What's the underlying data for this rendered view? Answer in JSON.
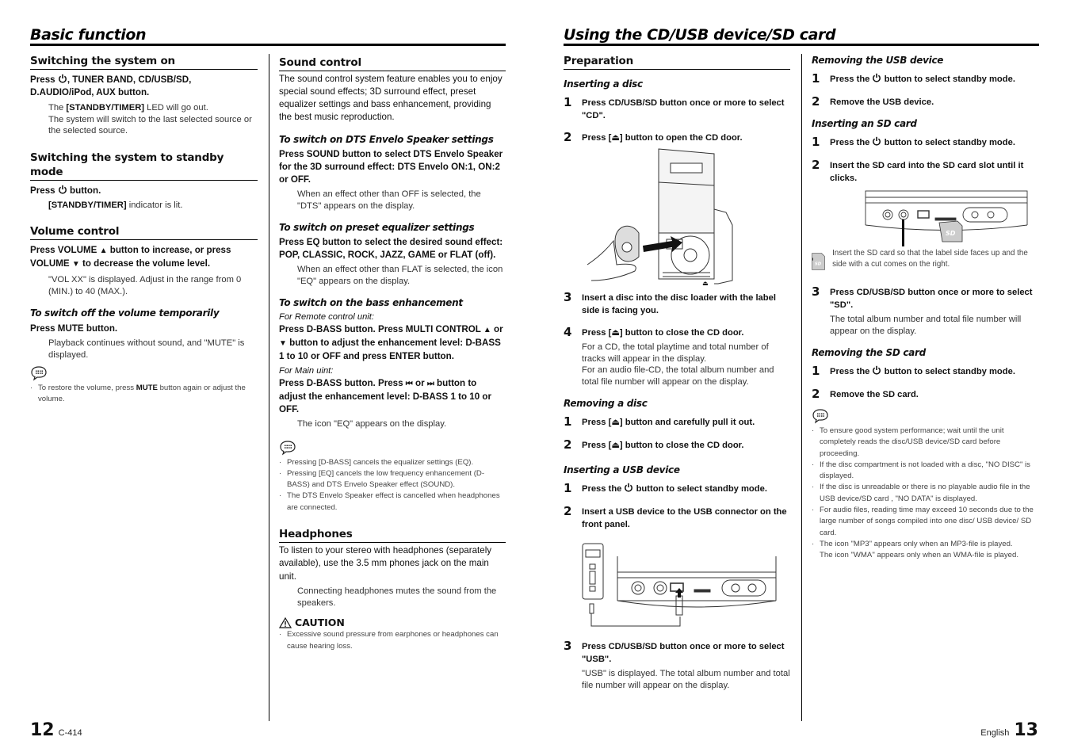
{
  "left_page": {
    "title": "Basic function",
    "page_number": "12",
    "model": "C-414",
    "sections": {
      "switch_on": {
        "heading": "Switching the system on",
        "instr_pre": "Press ",
        "instr_post": ", TUNER BAND, CD/USB/SD, D.AUDIO/iPod, AUX button.",
        "note1_pre": "The ",
        "note1_bold": "[STANDBY/TIMER]",
        "note1_post": " LED will go out.",
        "note2": "The system will switch to the last selected source or the selected source."
      },
      "standby": {
        "heading": "Switching the system to standby mode",
        "instr_pre": "Press ",
        "instr_post": " button.",
        "note_bold": "[STANDBY/TIMER]",
        "note_post": " indicator is lit."
      },
      "volume": {
        "heading": "Volume control",
        "instr_a": "Press VOLUME ",
        "up_glyph": "▲",
        "instr_b": " button to increase, or press VOLUME ",
        "down_glyph": "▼",
        "instr_c": " to decrease the volume level.",
        "note": "\"VOL XX\" is displayed. Adjust in the range from 0 (MIN.) to 40 (MAX.).",
        "mute_heading": "To switch off the volume temporarily",
        "mute_instr": "Press MUTE button.",
        "mute_note": "Playback continues without sound, and \"MUTE\" is displayed.",
        "memo_pre": "To restore the volume, press ",
        "memo_bold": "MUTE",
        "memo_post": " button again or adjust the volume."
      },
      "sound": {
        "heading": "Sound control",
        "intro": "The sound control system feature enables you to enjoy special sound effects; 3D surround effect, preset equalizer settings and bass enhancement, providing the best music reproduction.",
        "dts_heading": "To switch on DTS Envelo Speaker settings",
        "dts_instr": "Press SOUND button to select DTS Envelo Speaker for the 3D surround effect: DTS Envelo ON:1, ON:2 or OFF.",
        "dts_note": "When an effect other than OFF is selected, the \"DTS\" appears on the display.",
        "eq_heading": "To switch on preset equalizer settings",
        "eq_instr": "Press EQ button to select the desired sound effect: POP, CLASSIC, ROCK, JAZZ, GAME or FLAT (off).",
        "eq_note": "When an effect other than FLAT is selected, the icon \"EQ\" appears on the display.",
        "bass_heading": "To switch on the bass enhancement",
        "remote_label": "For Remote control unit:",
        "remote_instr_a": "Press D-BASS button. Press MULTI CONTROL ",
        "up_glyph": "▲",
        "remote_instr_b": " or ",
        "down_glyph": "▼",
        "remote_instr_c": " button to adjust the enhancement level: D-BASS 1 to 10 or OFF and press ENTER button.",
        "main_label": "For Main uint:",
        "main_instr_a": "Press D-BASS button. Press ",
        "prev_glyph": "⏮",
        "main_instr_b": " or ",
        "next_glyph": "⏭",
        "main_instr_c": "  button to adjust the enhancement level: D-BASS 1 to 10 or OFF.",
        "main_note": "The icon \"EQ\" appears on the display.",
        "memo": [
          "Pressing [D-BASS] cancels the equalizer settings (EQ).",
          "Pressing [EQ] cancels the low frequency enhancement (D-BASS) and DTS Envelo Speaker effect (SOUND).",
          "The DTS Envelo Speaker effect is cancelled when headphones are connected."
        ]
      },
      "headphones": {
        "heading": "Headphones",
        "intro": "To listen to your stereo with headphones (separately available), use the 3.5 mm phones jack on the main unit.",
        "note": "Connecting headphones mutes the sound from the speakers.",
        "caution_label": "CAUTION",
        "caution_items": [
          "Excessive sound pressure from earphones or headphones can cause hearing loss."
        ]
      }
    }
  },
  "right_page": {
    "title": "Using the CD/USB device/SD card",
    "language": "English",
    "page_number": "13",
    "preparation": {
      "heading": "Preparation",
      "inserting_disc": {
        "heading": "Inserting a disc",
        "steps": [
          {
            "num": "1",
            "text": "Press CD/USB/SD button once or more to select \"CD\"."
          },
          {
            "num": "2",
            "text_a": "Press [",
            "eject_glyph": "⏏",
            "text_b": "] button to open the CD door."
          },
          {
            "num": "3",
            "text": "Insert a disc into the disc loader with the label side is facing you."
          },
          {
            "num": "4",
            "text_a": "Press [",
            "eject_glyph": "⏏",
            "text_b": "] button to close the CD door.",
            "note1": "For a CD, the total playtime and total number of tracks will appear in the display.",
            "note2": "For an audio file-CD, the total album number and total file number will appear on the display."
          }
        ]
      },
      "removing_disc": {
        "heading": "Removing a disc",
        "steps": [
          {
            "num": "1",
            "text_a": "Press [",
            "eject_glyph": "⏏",
            "text_b": "] button and carefully pull it out."
          },
          {
            "num": "2",
            "text_a": "Press [",
            "eject_glyph": "⏏",
            "text_b": "] button to close the CD door."
          }
        ]
      },
      "inserting_usb": {
        "heading": "Inserting a USB device",
        "steps": [
          {
            "num": "1",
            "text_a": "Press the ",
            "text_b": " button to select standby mode."
          },
          {
            "num": "2",
            "text": "Insert a USB device to the USB connector on the front panel."
          },
          {
            "num": "3",
            "text": "Press CD/USB/SD button once or more to select \"USB\".",
            "note": "\"USB\" is displayed. The total album number and total file number will appear on the display."
          }
        ]
      },
      "removing_usb": {
        "heading": "Removing the USB device",
        "steps": [
          {
            "num": "1",
            "text_a": "Press the ",
            "text_b": " button to select standby mode."
          },
          {
            "num": "2",
            "text": "Remove the USB device."
          }
        ]
      },
      "inserting_sd": {
        "heading": "Inserting an SD card",
        "steps": [
          {
            "num": "1",
            "text_a": "Press the ",
            "text_b": " button to select standby mode."
          },
          {
            "num": "2",
            "text": "Insert the SD card into the SD card slot until it clicks."
          },
          {
            "num": "3",
            "text": "Press CD/USB/SD button once or more to select \"SD\".",
            "note": "The total album number and total file number will appear on the display."
          }
        ],
        "sd_caption": "Insert the SD card so that the label side faces up and the side with a cut comes on the right.",
        "sd_label": "SD"
      },
      "removing_sd": {
        "heading": "Removing the SD card",
        "steps": [
          {
            "num": "1",
            "text_a": "Press the ",
            "text_b": " button to select standby mode."
          },
          {
            "num": "2",
            "text": "Remove the SD card."
          }
        ]
      },
      "memo": [
        "To ensure good system performance; wait until the unit completely reads the disc/USB device/SD card before proceeding.",
        "If the disc compartment is not loaded with a disc, \"NO DISC\" is displayed.",
        "If the disc is unreadable or there is no playable audio file in the USB device/SD card , \"NO DATA\" is displayed.",
        "For audio files, reading time may exceed 10 seconds due to the large number of songs compiled into one disc/ USB device/ SD card.",
        "The icon \"MP3\" appears only when an MP3-file is played.\nThe icon \"WMA\" appears only when an WMA-file is played."
      ]
    }
  }
}
